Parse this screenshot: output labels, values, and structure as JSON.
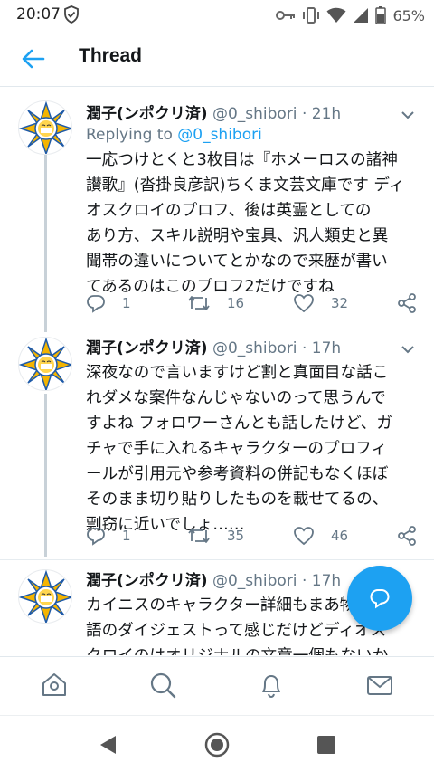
{
  "status_bar": {
    "time": "20:07",
    "battery": "65%",
    "icons": [
      "shield-icon",
      "key-icon",
      "vibrate-icon",
      "wifi-icon",
      "signal-icon",
      "battery-icon"
    ]
  },
  "header": {
    "back_icon": "back-arrow-icon",
    "title": "Thread"
  },
  "tweets": [
    {
      "name": "潤子(ンポクリ済)",
      "handle": "@0_shibori",
      "dot": "·",
      "time": "21h",
      "replying_label": "Replying to",
      "replying_to": "@0_shibori",
      "text": "一応つけとくと3枚目は『ホメーロスの諸神\n讃歌』(沓掛良彦訳)ちくま文芸文庫です ディ\nオスクロイのプロフ、後は英霊としての\nあり方、スキル説明や宝具、汎人類史と異\n聞帯の違いについてとかなので来歴が書い\nてあるのはこのプロフ2だけですね",
      "replies": "1",
      "retweets": "16",
      "likes": "32"
    },
    {
      "name": "潤子(ンポクリ済)",
      "handle": "@0_shibori",
      "dot": "·",
      "time": "17h",
      "text": "深夜なので言いますけど割と真面目な話こ\nれダメな案件なんじゃないのって思うんで\nすよね フォロワーさんとも話したけど、ガ\nチャで手に入れるキャラクターのプロフィ\nールが引用元や参考資料の併記もなくほぼ\nそのまま切り貼りしたものを載せてるの、\n剽窃に近いでしょ……",
      "replies": "1",
      "retweets": "35",
      "likes": "46"
    },
    {
      "name": "潤子(ンポクリ済)",
      "handle": "@0_shibori",
      "dot": "·",
      "time": "17h",
      "text": "カイニスのキャラクター詳細もまあ物\n語のダイジェストって感じだけどディオス\nクロイのはオリジナルの文章一個もないか"
    }
  ],
  "fab": {
    "icon": "compose-reply-icon"
  },
  "bottom_nav": [
    "home-icon",
    "search-icon",
    "notifications-icon",
    "messages-icon"
  ],
  "system_nav": [
    "back-triangle-icon",
    "home-circle-icon",
    "recents-square-icon"
  ],
  "colors": {
    "accent": "#1da1f2",
    "text": "#14171a",
    "secondary": "#657786",
    "divider": "#e6ecf0"
  }
}
